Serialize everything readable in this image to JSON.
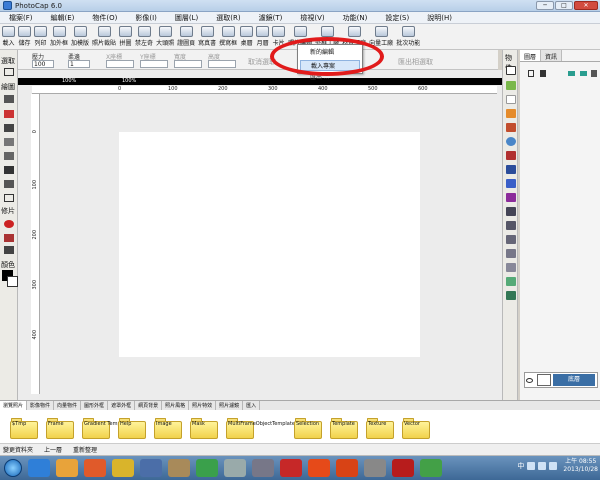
{
  "window": {
    "title": "PhotoCap 6.0",
    "minimize": "─",
    "maximize": "□",
    "close": "✕"
  },
  "menubar": [
    "檔案(F)",
    "編輯(E)",
    "物件(O)",
    "影像(I)",
    "圖層(L)",
    "選取(R)",
    "濾鏡(T)",
    "檢視(V)",
    "功能(N)",
    "設定(S)",
    "說明(H)"
  ],
  "toolbar": [
    {
      "label": "載入",
      "icon": "open-icon"
    },
    {
      "label": "儲存",
      "icon": "save-icon"
    },
    {
      "label": "列印",
      "icon": "print-icon"
    },
    {
      "label": "加外框",
      "icon": "frame-icon"
    },
    {
      "label": "加模版",
      "icon": "template-icon"
    },
    {
      "label": "照片裁貼",
      "icon": "crop-icon"
    },
    {
      "label": "拼圖",
      "icon": "collage-icon"
    },
    {
      "label": "禁左奇",
      "icon": "tool-icon"
    },
    {
      "label": "大頭照",
      "icon": "portrait-icon"
    },
    {
      "label": "證圖頁",
      "icon": "page-icon"
    },
    {
      "label": "寫真書",
      "icon": "book-icon"
    },
    {
      "label": "撰寫框",
      "icon": "write-icon"
    },
    {
      "label": "桌曆",
      "icon": "calendar-icon"
    },
    {
      "label": "月曆",
      "icon": "month-calendar-icon"
    },
    {
      "label": "卡片",
      "icon": "card-icon"
    },
    {
      "label": "照片編輯",
      "icon": "photo-edit-icon"
    },
    {
      "label": "外框工廠",
      "icon": "frame-factory-icon"
    },
    {
      "label": "材質工廠",
      "icon": "texture-factory-icon"
    },
    {
      "label": "向量工廠",
      "icon": "vector-factory-icon"
    },
    {
      "label": "批次功能",
      "icon": "batch-icon"
    }
  ],
  "dropdown": {
    "items": [
      "新的編輯",
      "載入專案"
    ],
    "partial": "匯出 ..."
  },
  "propbar": {
    "pressure_label": "壓力",
    "pressure_value": "100",
    "opacity_label": "柔邊",
    "opacity_value": "1",
    "x_label": "X座標",
    "y_label": "Y座標",
    "w_label": "寬度",
    "h_label": "高度",
    "cancel_label": "取消選取",
    "export_label": "匯出相選取"
  },
  "leftbar": {
    "select_label": "選取",
    "draw_label": "繪圖",
    "photo_label": "修片",
    "color_label": "顏色"
  },
  "ruler": {
    "zoom_left": "100%",
    "zoom_right": "100%",
    "h_marks": [
      "0",
      "100",
      "200",
      "300",
      "400",
      "500",
      "600"
    ],
    "v_marks": [
      "0",
      "100",
      "200",
      "300",
      "400"
    ]
  },
  "objbar_label": "物件",
  "layers": {
    "tabs": [
      "圖層",
      "資訊"
    ],
    "layer_name": "底層"
  },
  "bottom_tabs": [
    "瀏覽照片",
    "影像物件",
    "向量物件",
    "圖形外框",
    "遮罩外框",
    "網頁背景",
    "照片風格",
    "照片特效",
    "照片濾鏡",
    "匯入"
  ],
  "folders": [
    "$Tmp",
    "Frame",
    "Gradient Template",
    "Help",
    "Image",
    "Mask",
    "MultiFrameObjectTemplate",
    "Selection",
    "Template",
    "Texture",
    "Vector"
  ],
  "status": {
    "left": "變更資料夾",
    "middle": "上一層",
    "right": "重新整理"
  },
  "taskbar": {
    "time_label": "上午 08:55",
    "date_label": "2013/10/28",
    "lang": "中"
  },
  "colors": {
    "accent": "#3a6ea5",
    "highlight": "#e11b1b"
  }
}
